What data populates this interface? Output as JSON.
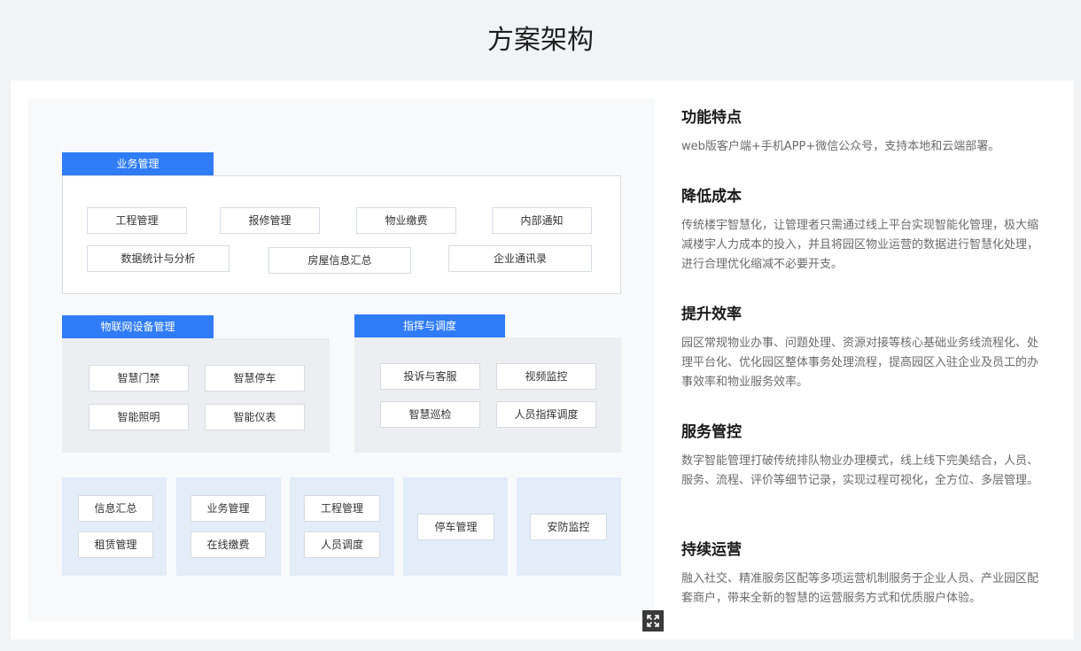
{
  "page_title": "方案架构",
  "diagram": {
    "business": {
      "title": "业务管理",
      "chips": [
        "工程管理",
        "报修管理",
        "物业缴费",
        "内部通知",
        "数据统计与分析",
        "房屋信息汇总",
        "企业通讯录"
      ]
    },
    "iot": {
      "title": "物联网设备管理",
      "chips": [
        "智慧门禁",
        "智慧停车",
        "智能照明",
        "智能仪表"
      ]
    },
    "command": {
      "title": "指挥与调度",
      "chips": [
        "投诉与客服",
        "视频监控",
        "智慧巡检",
        "人员指挥调度"
      ]
    },
    "columns": [
      {
        "chips": [
          "信息汇总",
          "租赁管理"
        ]
      },
      {
        "chips": [
          "业务管理",
          "在线缴费"
        ]
      },
      {
        "chips": [
          "工程管理",
          "人员调度"
        ]
      },
      {
        "chips": [
          "停车管理"
        ]
      },
      {
        "chips": [
          "安防监控"
        ]
      }
    ],
    "expand_icon": "expand-icon"
  },
  "features": [
    {
      "title": "功能特点",
      "desc": "web版客户端+手机APP+微信公众号，支持本地和云端部署。"
    },
    {
      "title": "降低成本",
      "desc": "传统楼宇智慧化，让管理者只需通过线上平台实现智能化管理，极大缩减楼宇人力成本的投入，并且将园区物业运营的数据进行智慧化处理，进行合理优化缩减不必要开支。"
    },
    {
      "title": "提升效率",
      "desc": "园区常规物业办事、问题处理、资源对接等核心基础业务线流程化、处理平台化、优化园区整体事务处理流程，提高园区入驻企业及员工的办事效率和物业服务效率。"
    },
    {
      "title": "服务管控",
      "desc": "数字智能管理打破传统排队物业办理模式，线上线下完美结合，人员、服务、流程、评价等细节记录，实现过程可视化，全方位、多层管理。"
    },
    {
      "title": "持续运营",
      "desc": "融入社交、精准服务区配等多项运营机制服务于企业人员、产业园区配套商户，带来全新的智慧的运营服务方式和优质服户体验。"
    }
  ],
  "colors": {
    "accent": "#2f7cf6",
    "panel_gray": "#eceef1",
    "panel_blue": "#e3ecf9"
  }
}
